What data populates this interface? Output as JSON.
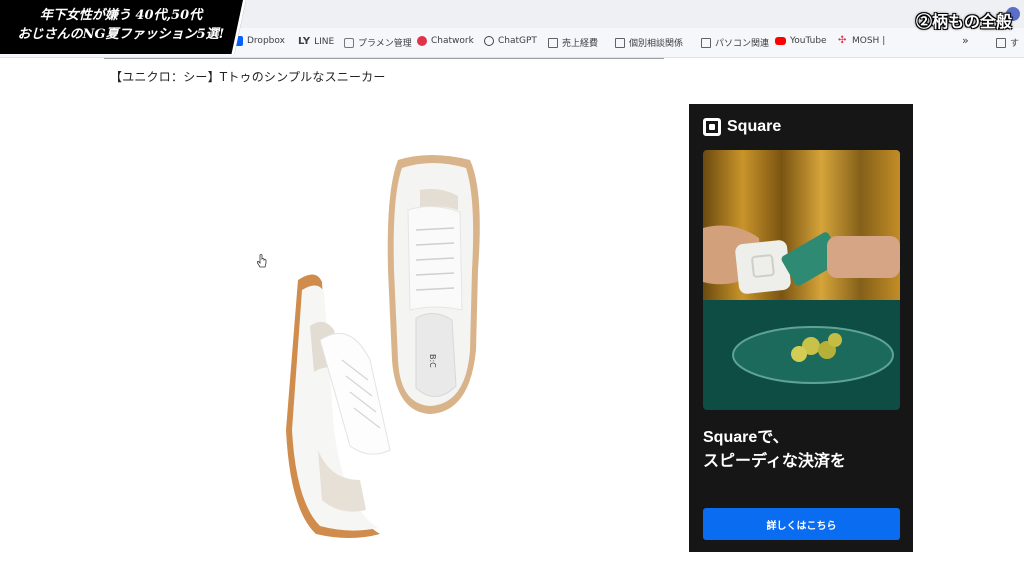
{
  "video_overlay": {
    "title_line1": "年下女性が嫌う 40代,50代",
    "title_line2": "おじさんのNG夏ファッション5選!",
    "chapter_label": "②柄もの全般"
  },
  "bookmarks": [
    {
      "label": "Dropbox",
      "icon": "dropbox-icon",
      "color": "#0061fe"
    },
    {
      "label": "LINE",
      "icon": "line-icon",
      "color": "#000000"
    },
    {
      "label": "プラメン管理",
      "icon": "puzzle-icon",
      "color": "#555555"
    },
    {
      "label": "Chatwork",
      "icon": "chatwork-icon",
      "color": "#e0324b"
    },
    {
      "label": "ChatGPT",
      "icon": "chatgpt-icon",
      "color": "#444444"
    },
    {
      "label": "売上経費",
      "icon": "folder-icon",
      "color": "#5f6368"
    },
    {
      "label": "個別相談関係",
      "icon": "folder-icon",
      "color": "#5f6368"
    },
    {
      "label": "パソコン関連",
      "icon": "folder-icon",
      "color": "#5f6368"
    },
    {
      "label": "YouTube",
      "icon": "youtube-icon",
      "color": "#ff0000"
    },
    {
      "label": "MOSH |",
      "icon": "mosh-icon",
      "color": "#e0324b"
    }
  ],
  "bookmarks_overflow": "»",
  "bookmarks_other": "す",
  "article": {
    "heading": "【ユニクロ：シー】Tトゥのシンプルなスニーカー",
    "shoe_insole_mark": "B:C"
  },
  "ad": {
    "brand": "Square",
    "headline_line1": "Squareで、",
    "headline_line2": "スピーディな決済を",
    "button_label": "詳しくはこちら",
    "background_color": "#161616",
    "button_color": "#0a6cf0"
  }
}
